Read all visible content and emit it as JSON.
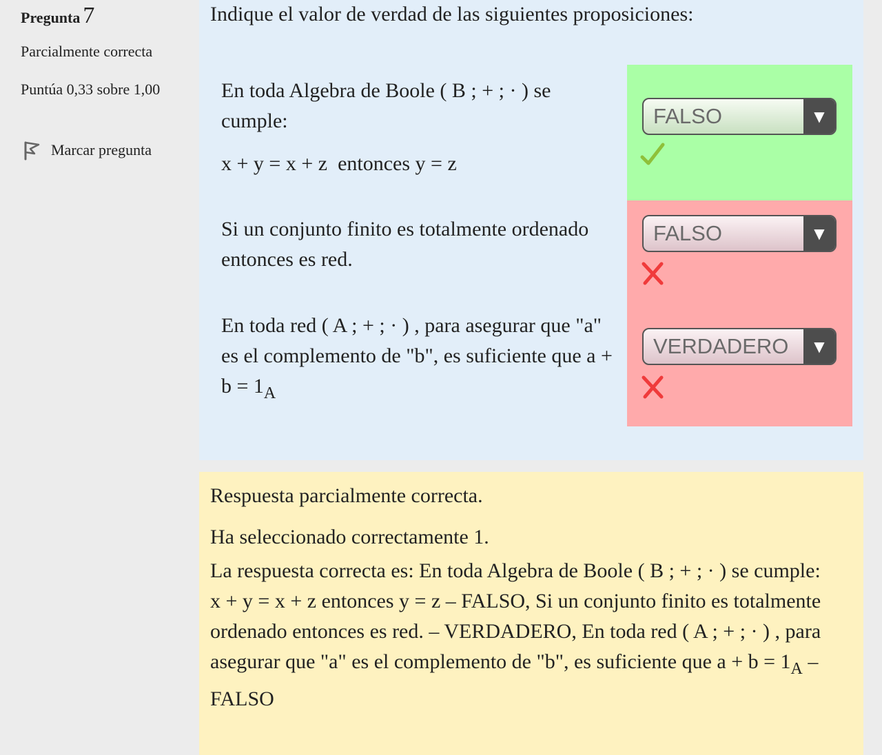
{
  "info": {
    "question_label": "Pregunta",
    "question_number": "7",
    "state": "Parcialmente correcta",
    "grade": "Puntúa 0,33 sobre 1,00",
    "flag_label": "Marcar pregunta"
  },
  "question": {
    "text": "Indique el valor de verdad de las siguientes proposiciones:",
    "items": [
      {
        "statement": "En toda Algebra de Boole ( B ; + ; · ) se cumple:",
        "formula": "x + y = x + z  entonces y = z",
        "selected": "FALSO",
        "result": "correct",
        "result_icon": "check-icon"
      },
      {
        "statement": "Si un conjunto finito es totalmente ordenado entonces es red.",
        "selected": "FALSO",
        "result": "incorrect",
        "result_icon": "cross-icon"
      },
      {
        "statement_main": "En toda red ( A ; + ; · ) , para asegurar que \"a\" es el complemento de \"b\", es suficiente que a + b = 1",
        "statement_sub": "A",
        "selected": "VERDADERO",
        "result": "incorrect",
        "result_icon": "cross-icon"
      }
    ]
  },
  "feedback": {
    "summary": "Respuesta parcialmente correcta.",
    "selected_count": "Ha seleccionado correctamente 1.",
    "correct_answer_main": "La respuesta correcta es: En toda Algebra de Boole ( B ; + ; · ) se cumple:\nx + y = x + z  entonces y = z – FALSO, Si un conjunto finito es totalmente ordenado entonces es red. – VERDADERO, En toda red ( A ; + ; · ) , para asegurar que \"a\" es el complemento de \"b\", es suficiente que a + b = 1",
    "correct_answer_sub": "A",
    "correct_answer_tail": " – FALSO"
  },
  "colors": {
    "correct_bg": "#aaffa6",
    "incorrect_bg": "#ffaaab",
    "question_bg": "#e2eef9",
    "feedback_bg": "#fef2c0",
    "check": "#8fc03a",
    "cross": "#f03b3b"
  }
}
